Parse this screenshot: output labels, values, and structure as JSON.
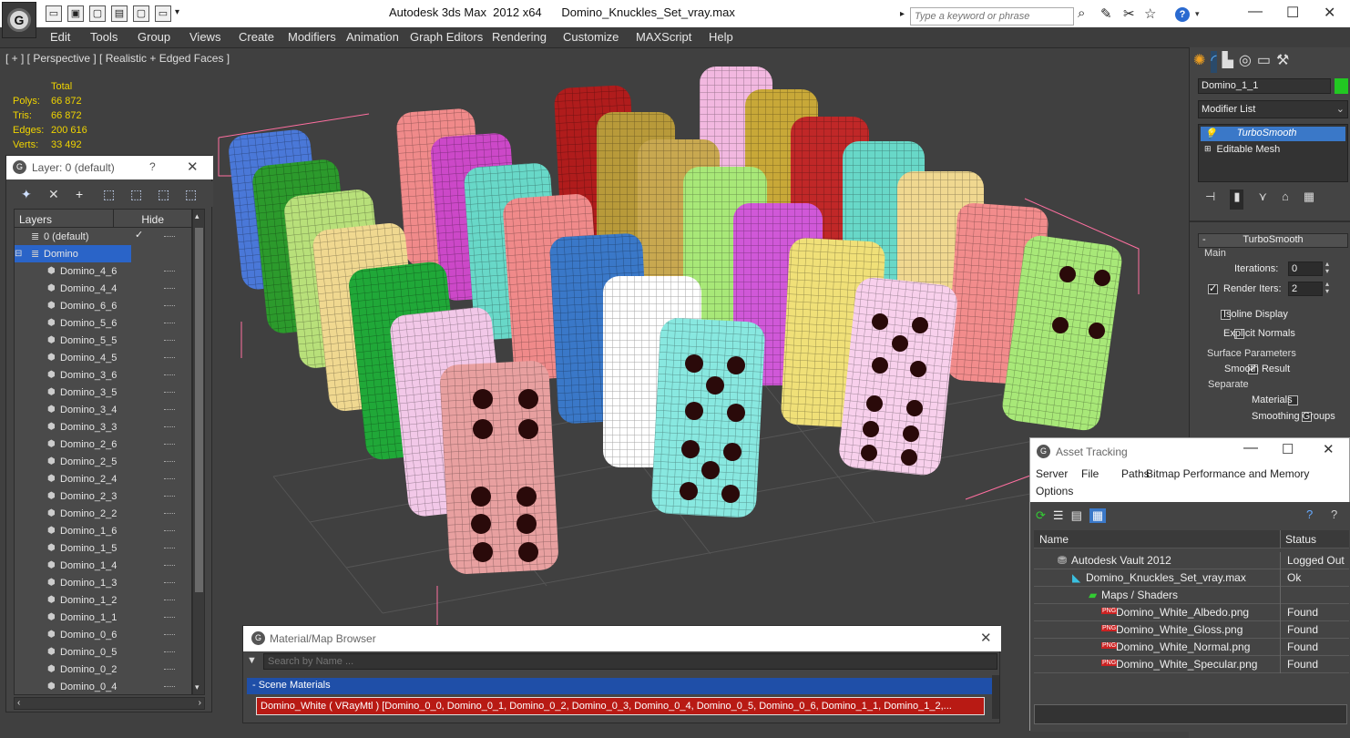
{
  "titlebar": {
    "title": "Autodesk 3ds Max  2012 x64      Domino_Knuckles_Set_vray.max",
    "search_placeholder": "Type a keyword or phrase"
  },
  "menu": [
    "Edit",
    "Tools",
    "Group",
    "Views",
    "Create",
    "Modifiers",
    "Animation",
    "Graph Editors",
    "Rendering",
    "Customize",
    "MAXScript",
    "Help"
  ],
  "viewport": {
    "label": "[ + ] [ Perspective ] [ Realistic + Edged Faces ]",
    "stats": {
      "header": "Total",
      "rows": [
        {
          "k": "Polys:",
          "v": "66 872"
        },
        {
          "k": "Tris:",
          "v": "66 872"
        },
        {
          "k": "Edges:",
          "v": "200 616"
        },
        {
          "k": "Verts:",
          "v": "33 492"
        }
      ]
    }
  },
  "layer_panel": {
    "title": "Layer: 0 (default)",
    "help": "?",
    "col_layers": "Layers",
    "col_hide": "Hide",
    "layers": [
      {
        "name": "0 (default)",
        "level": 0,
        "checked": true
      },
      {
        "name": "Domino",
        "level": 0,
        "selected": true
      }
    ],
    "objects": [
      "Domino_4_6",
      "Domino_4_4",
      "Domino_6_6",
      "Domino_5_6",
      "Domino_5_5",
      "Domino_4_5",
      "Domino_3_6",
      "Domino_3_5",
      "Domino_3_4",
      "Domino_3_3",
      "Domino_2_6",
      "Domino_2_5",
      "Domino_2_4",
      "Domino_2_3",
      "Domino_2_2",
      "Domino_1_6",
      "Domino_1_5",
      "Domino_1_4",
      "Domino_1_3",
      "Domino_1_2",
      "Domino_1_1",
      "Domino_0_6",
      "Domino_0_5",
      "Domino_0_2",
      "Domino_0_4"
    ]
  },
  "material_browser": {
    "title": "Material/Map Browser",
    "search_placeholder": "Search by Name ...",
    "section": "- Scene Materials",
    "item": "Domino_White  ( VRayMtl ) [Domino_0_0, Domino_0_1, Domino_0_2, Domino_0_3, Domino_0_4, Domino_0_5, Domino_0_6, Domino_1_1, Domino_1_2,..."
  },
  "command_panel": {
    "object_name": "Domino_1_1",
    "modifier_list": "Modifier List",
    "stack": [
      "TurboSmooth",
      "Editable Mesh"
    ],
    "rollout_title": "TurboSmooth",
    "main_label": "Main",
    "iterations_label": "Iterations:",
    "iterations_value": "0",
    "render_iters_label": "Render Iters:",
    "render_iters_value": "2",
    "isoline_label": "Isoline Display",
    "explicit_normals_label": "Explicit Normals",
    "surface_params_label": "Surface Parameters",
    "smooth_result_label": "Smooth Result",
    "separate_label": "Separate",
    "materials_label": "Materials",
    "smoothing_groups_label": "Smoothing Groups"
  },
  "asset_tracking": {
    "title": "Asset Tracking",
    "menu": [
      "Server",
      "File",
      "Paths",
      "Bitmap Performance and Memory",
      "Options"
    ],
    "col_name": "Name",
    "col_status": "Status",
    "rows": [
      {
        "name": "Autodesk Vault 2012",
        "status": "Logged Out",
        "indent": 1
      },
      {
        "name": "Domino_Knuckles_Set_vray.max",
        "status": "Ok",
        "indent": 2
      },
      {
        "name": "Maps / Shaders",
        "status": "",
        "indent": 3
      },
      {
        "name": "Domino_White_Albedo.png",
        "status": "Found",
        "indent": 4
      },
      {
        "name": "Domino_White_Gloss.png",
        "status": "Found",
        "indent": 4
      },
      {
        "name": "Domino_White_Normal.png",
        "status": "Found",
        "indent": 4
      },
      {
        "name": "Domino_White_Specular.png",
        "status": "Found",
        "indent": 4
      }
    ]
  },
  "colors": {
    "accent_blue": "#3a78c8",
    "stats_yellow": "#f0d400",
    "selected_item": "#2a64c8",
    "scene_materials_bar": "#1f4fa8",
    "material_red": "#b81a14",
    "bbox_pink": "#ff6fa0"
  }
}
